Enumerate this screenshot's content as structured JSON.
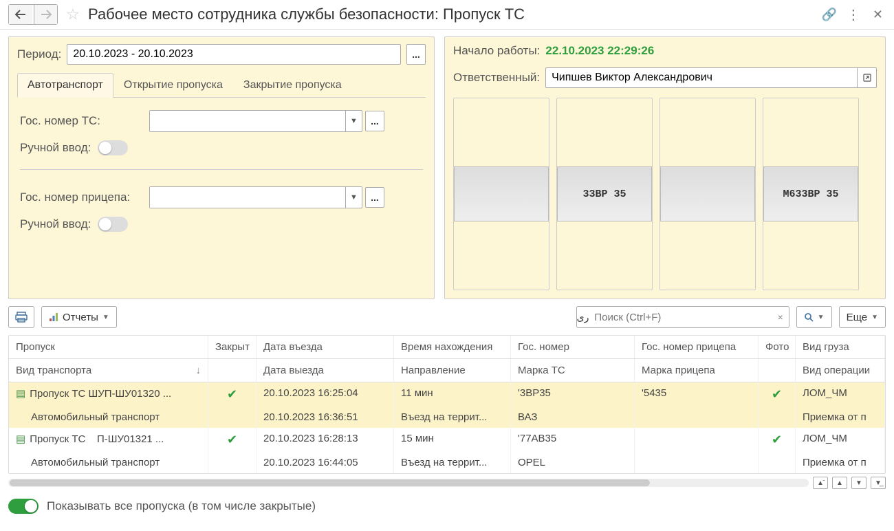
{
  "header": {
    "title": "Рабочее место сотрудника службы безопасности: Пропуск ТС"
  },
  "period": {
    "label": "Период:",
    "value": "20.10.2023 - 20.10.2023"
  },
  "tabs": [
    {
      "label": "Автотранспорт",
      "active": true
    },
    {
      "label": "Открытие пропуска",
      "active": false
    },
    {
      "label": "Закрытие пропуска",
      "active": false
    }
  ],
  "vehicle_form": {
    "plate_label": "Гос. номер ТС:",
    "plate_value": "",
    "manual_label1": "Ручной ввод:",
    "trailer_label": "Гос. номер прицепа:",
    "trailer_value": "",
    "manual_label2": "Ручной ввод:"
  },
  "right": {
    "start_label": "Начало работы:",
    "start_value": "22.10.2023 22:29:26",
    "responsible_label": "Ответственный:",
    "responsible_value": "Чипшев Виктор Александрович",
    "thumbs": [
      {
        "text": ""
      },
      {
        "text": "33ВР 35"
      },
      {
        "text": ""
      },
      {
        "text": "М633ВР 35"
      }
    ]
  },
  "toolbar": {
    "reports_label": "Отчеты",
    "search_placeholder": "Поиск (Ctrl+F)",
    "more_label": "Еще"
  },
  "table": {
    "cols": {
      "pass": "Пропуск",
      "closed": "Закрыт",
      "date_in": "Дата въезда",
      "time": "Время нахождения",
      "plate": "Гос. номер",
      "trailer": "Гос. номер прицепа",
      "photo": "Фото",
      "cargo": "Вид груза"
    },
    "subcols": {
      "transport_kind": "Вид транспорта",
      "date_out": "Дата выезда",
      "direction": "Направление",
      "brand": "Марка ТС",
      "trailer_brand": "Марка прицепа",
      "op_kind": "Вид операции"
    },
    "rows": [
      {
        "pass": "Пропуск ТС   ШУП-ШУ01320 ...",
        "closed": true,
        "date_in": "20.10.2023 16:25:04",
        "time": "11 мин",
        "plate": "'3ВР35",
        "trailer": "'5435",
        "photo": true,
        "cargo": "ЛОМ_ЧМ",
        "transport_kind": "Автомобильный транспорт",
        "date_out": "20.10.2023 16:36:51",
        "direction": "Въезд на террит...",
        "brand": "ВАЗ",
        "trailer_brand": "",
        "op_kind": "Приемка от п",
        "selected": true
      },
      {
        "pass": "Пропуск ТС    П-ШУ01321 ...",
        "closed": true,
        "date_in": "20.10.2023 16:28:13",
        "time": "15 мин",
        "plate": "'77АВ35",
        "trailer": "",
        "photo": true,
        "cargo": "ЛОМ_ЧМ",
        "transport_kind": "Автомобильный транспорт",
        "date_out": "20.10.2023 16:44:05",
        "direction": "Въезд на террит...",
        "brand": "OPEL",
        "trailer_brand": "",
        "op_kind": "Приемка от п",
        "selected": false
      }
    ]
  },
  "footer": {
    "show_all_label": "Показывать все пропуска (в том числе закрытые)"
  }
}
